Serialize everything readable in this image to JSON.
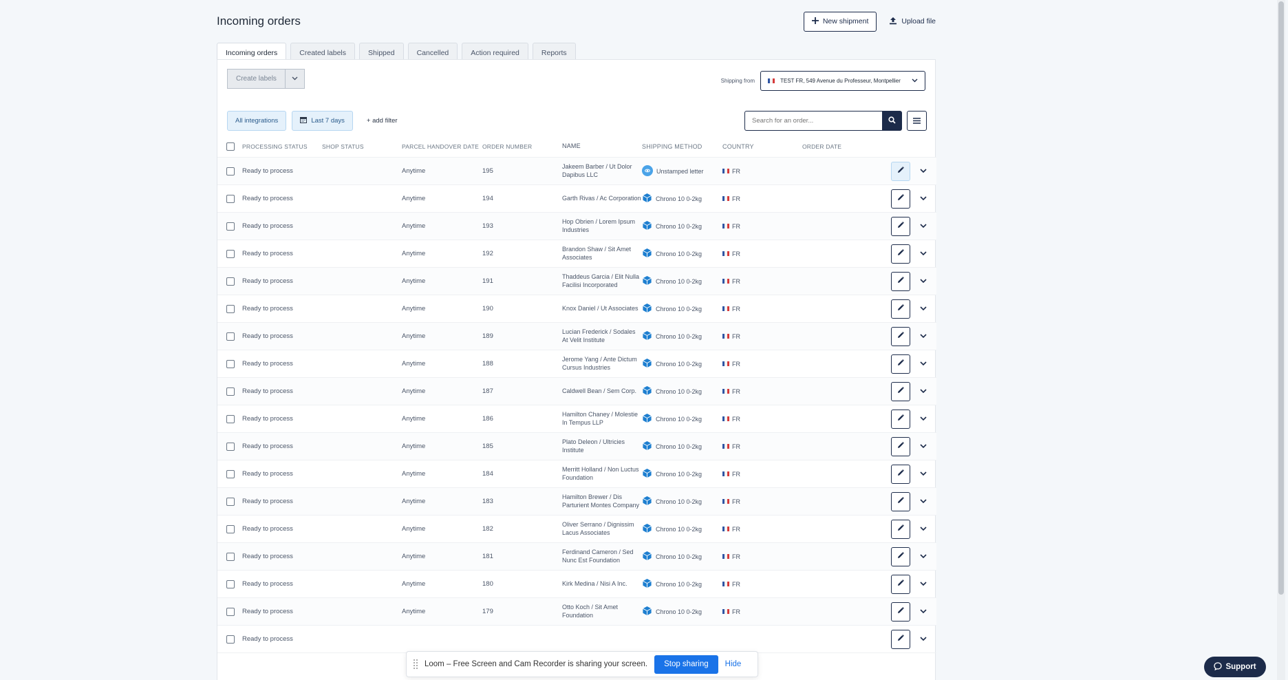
{
  "page": {
    "title": "Incoming orders",
    "new_shipment_label": "New shipment",
    "upload_file_label": "Upload file"
  },
  "tabs": [
    {
      "label": "Incoming orders",
      "active": true
    },
    {
      "label": "Created labels",
      "active": false
    },
    {
      "label": "Shipped",
      "active": false
    },
    {
      "label": "Cancelled",
      "active": false
    },
    {
      "label": "Action required",
      "active": false
    },
    {
      "label": "Reports",
      "active": false
    }
  ],
  "toolbar": {
    "create_labels": "Create labels",
    "shipping_from_label": "Shipping from",
    "shipping_from_value": "TEST FR, 549 Avenue du Professeur, Montpellier"
  },
  "filters": {
    "integrations": "All integrations",
    "date_range": "Last 7 days",
    "add_filter": "+ add filter",
    "search_placeholder": "Search for an order..."
  },
  "table": {
    "headers": {
      "processing_status": "PROCESSING STATUS",
      "shop_status": "SHOP STATUS",
      "handover": "PARCEL HANDOVER DATE",
      "order_number": "ORDER NUMBER",
      "name": "NAME",
      "shipping_method": "SHIPPING METHOD",
      "country": "COUNTRY",
      "order_date": "ORDER DATE"
    },
    "rows": [
      {
        "status": "Ready to process",
        "handover": "Anytime",
        "number": "195",
        "name": "Jakeem Barber / Ut Dolor Dapibus LLC",
        "method": "Unstamped letter",
        "country": "FR"
      },
      {
        "status": "Ready to process",
        "handover": "Anytime",
        "number": "194",
        "name": "Garth Rivas / Ac Corporation",
        "method": "Chrono 10 0-2kg",
        "country": "FR"
      },
      {
        "status": "Ready to process",
        "handover": "Anytime",
        "number": "193",
        "name": "Hop Obrien / Lorem Ipsum Industries",
        "method": "Chrono 10 0-2kg",
        "country": "FR"
      },
      {
        "status": "Ready to process",
        "handover": "Anytime",
        "number": "192",
        "name": "Brandon Shaw / Sit Amet Associates",
        "method": "Chrono 10 0-2kg",
        "country": "FR"
      },
      {
        "status": "Ready to process",
        "handover": "Anytime",
        "number": "191",
        "name": "Thaddeus Garcia / Elit Nulla Facilisi Incorporated",
        "method": "Chrono 10 0-2kg",
        "country": "FR"
      },
      {
        "status": "Ready to process",
        "handover": "Anytime",
        "number": "190",
        "name": "Knox Daniel / Ut Associates",
        "method": "Chrono 10 0-2kg",
        "country": "FR"
      },
      {
        "status": "Ready to process",
        "handover": "Anytime",
        "number": "189",
        "name": "Lucian Frederick / Sodales At Velit Institute",
        "method": "Chrono 10 0-2kg",
        "country": "FR"
      },
      {
        "status": "Ready to process",
        "handover": "Anytime",
        "number": "188",
        "name": "Jerome Yang / Ante Dictum Cursus Industries",
        "method": "Chrono 10 0-2kg",
        "country": "FR"
      },
      {
        "status": "Ready to process",
        "handover": "Anytime",
        "number": "187",
        "name": "Caldwell Bean / Sem Corp.",
        "method": "Chrono 10 0-2kg",
        "country": "FR"
      },
      {
        "status": "Ready to process",
        "handover": "Anytime",
        "number": "186",
        "name": "Hamilton Chaney / Molestie In Tempus LLP",
        "method": "Chrono 10 0-2kg",
        "country": "FR"
      },
      {
        "status": "Ready to process",
        "handover": "Anytime",
        "number": "185",
        "name": "Plato Deleon / Ultricies Institute",
        "method": "Chrono 10 0-2kg",
        "country": "FR"
      },
      {
        "status": "Ready to process",
        "handover": "Anytime",
        "number": "184",
        "name": "Merritt Holland / Non Luctus Foundation",
        "method": "Chrono 10 0-2kg",
        "country": "FR"
      },
      {
        "status": "Ready to process",
        "handover": "Anytime",
        "number": "183",
        "name": "Hamilton Brewer / Dis Parturient Montes Company",
        "method": "Chrono 10 0-2kg",
        "country": "FR"
      },
      {
        "status": "Ready to process",
        "handover": "Anytime",
        "number": "182",
        "name": "Oliver Serrano / Dignissim Lacus Associates",
        "method": "Chrono 10 0-2kg",
        "country": "FR"
      },
      {
        "status": "Ready to process",
        "handover": "Anytime",
        "number": "181",
        "name": "Ferdinand Cameron / Sed Nunc Est Foundation",
        "method": "Chrono 10 0-2kg",
        "country": "FR"
      },
      {
        "status": "Ready to process",
        "handover": "Anytime",
        "number": "180",
        "name": "Kirk Medina / Nisi A Inc.",
        "method": "Chrono 10 0-2kg",
        "country": "FR"
      },
      {
        "status": "Ready to process",
        "handover": "Anytime",
        "number": "179",
        "name": "Otto Koch / Sit Amet Foundation",
        "method": "Chrono 10 0-2kg",
        "country": "FR"
      },
      {
        "status": "Ready to process",
        "handover": "",
        "number": "",
        "name": "",
        "method": "",
        "country": ""
      }
    ]
  },
  "loom": {
    "text": "Loom – Free Screen and Cam Recorder is sharing your screen.",
    "stop": "Stop sharing",
    "hide": "Hide"
  },
  "support": {
    "label": "Support"
  },
  "colors": {
    "primary": "#1c2b4a",
    "chip_bg": "#e5f1fb",
    "method_blue": "#1e7fd0"
  }
}
